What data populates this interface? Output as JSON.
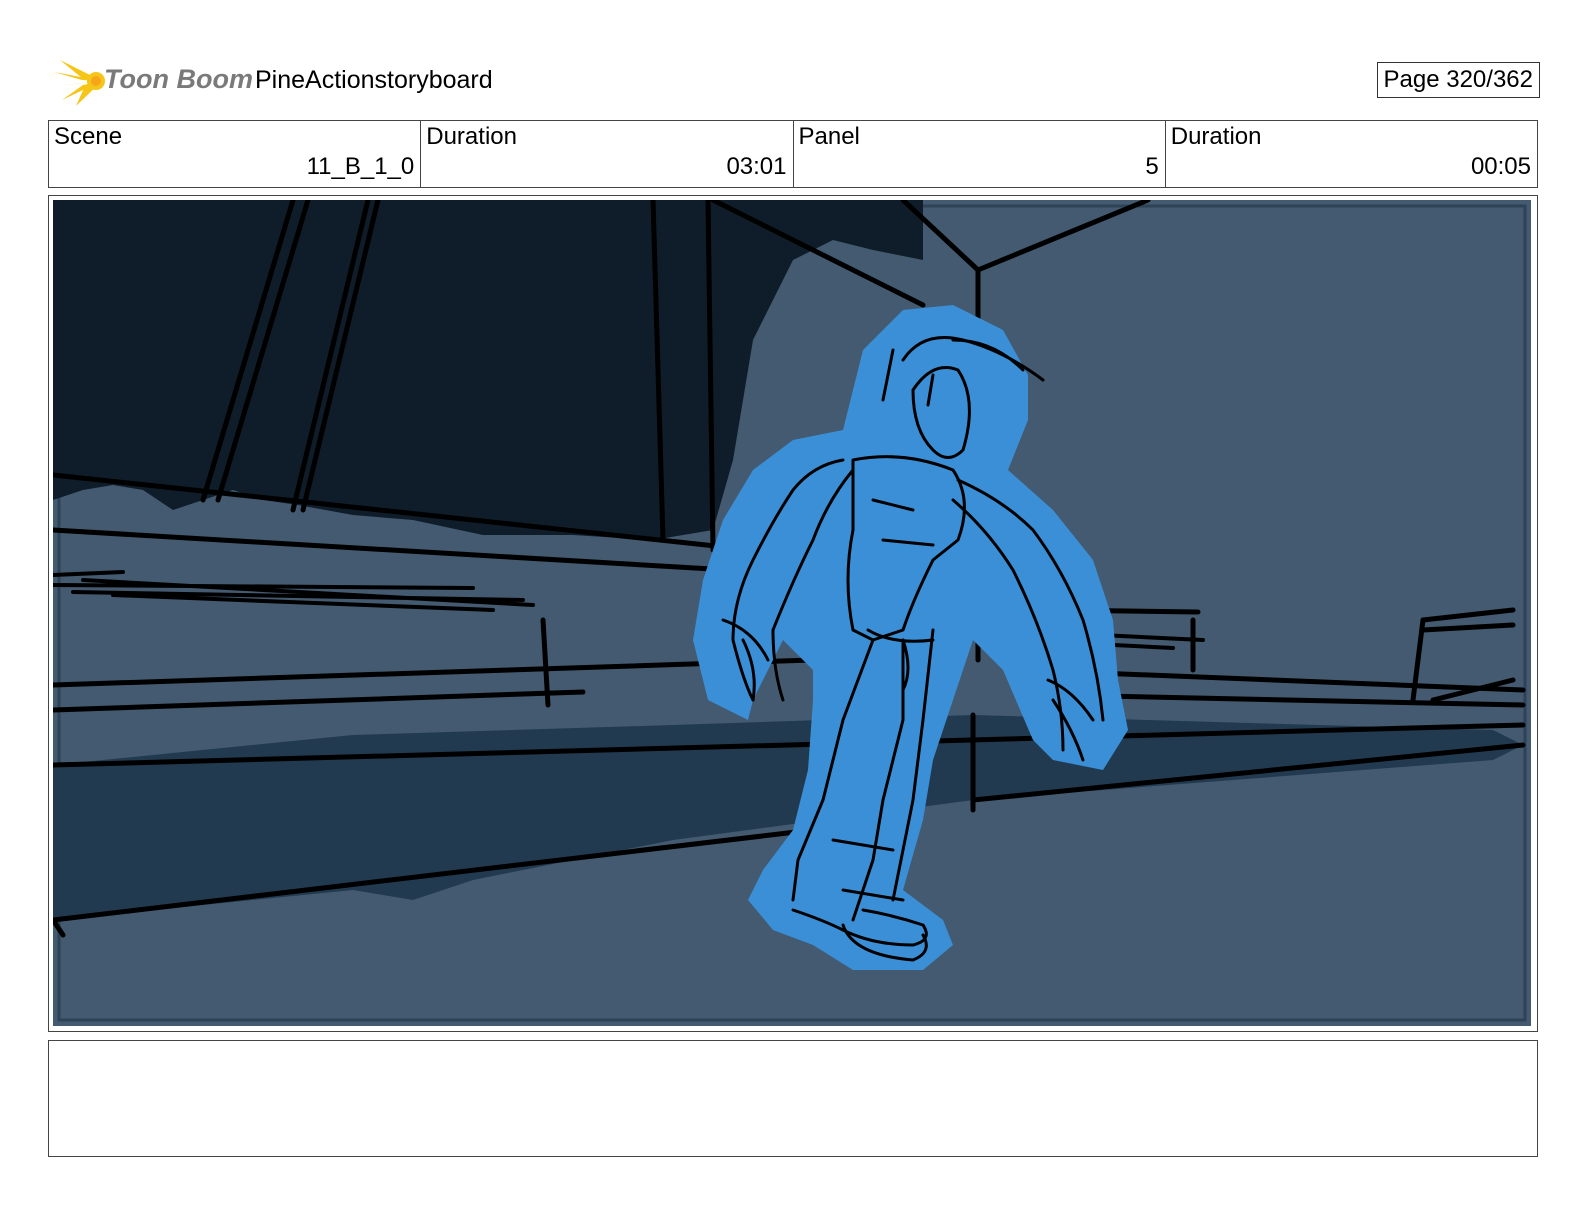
{
  "header": {
    "logo_text": "Toon Boom",
    "project_title": "PineActionstoryboard",
    "page_label": "Page 320/362"
  },
  "info": {
    "scene_label": "Scene",
    "scene_value": "11_B_1_0",
    "scene_duration_label": "Duration",
    "scene_duration_value": "03:01",
    "panel_label": "Panel",
    "panel_value": "5",
    "panel_duration_label": "Duration",
    "panel_duration_value": "00:05"
  },
  "notes": {
    "text": ""
  },
  "colors": {
    "logo_accent": "#f5c518",
    "background_wall": "#435a70",
    "dark_shapes": "#0f1d2a",
    "character_fill": "#3b8fd6",
    "line_art": "#000000"
  }
}
